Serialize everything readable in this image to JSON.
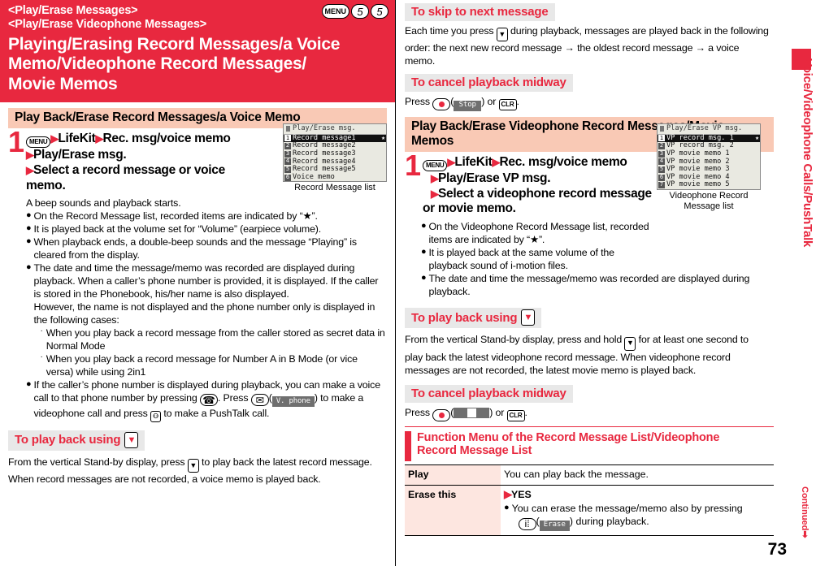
{
  "colors": {
    "accent": "#e8283f",
    "pink_bar": "#f9c9b5",
    "grey_hdr": "#e8e8e8",
    "table_key": "#fde6e0"
  },
  "header": {
    "sub_line1": "<Play/Erase Messages>",
    "sub_line2": "<Play/Erase Videophone Messages>",
    "title_line1": "Playing/Erasing Record Messages/a Voice",
    "title_line2": "Memo/Videophone Record Messages/",
    "title_line3": "Movie Memos",
    "keys": [
      "MENU",
      "5",
      "5"
    ]
  },
  "left": {
    "section_title": "Play Back/Erase Record Messages/a Voice Memo",
    "step": {
      "number": "1",
      "menu_key": "MENU",
      "line1_a": "LifeKit",
      "line1_b": "Rec. msg/voice memo",
      "line2": "Play/Erase msg.",
      "line3": "Select a record message or voice",
      "line4": "memo."
    },
    "intro": "A beep sounds and playback starts.",
    "bullets": [
      "On the Record Message list, recorded items are indicated by “★”.",
      "It is played back at the volume set for “Volume” (earpiece volume).",
      "When playback ends, a double-beep sounds and the message “Playing” is cleared from the display."
    ],
    "bullet_date": {
      "p1": "The date and time the message/memo was recorded are displayed during playback. When a caller’s phone number is provided, it is displayed. If the caller is stored in the Phonebook, his/her name is also displayed.",
      "p2": "However, the name is not displayed and the phone number only is displayed in the following cases:",
      "cases": [
        "When you play back a record message from the caller stored as secret data in Normal Mode",
        "When you play back a record message for Number A in B Mode (or vice versa) while using 2in1"
      ]
    },
    "bullet_call": {
      "a": "If the caller’s phone number is displayed during playback, you can make a voice call to that phone number by pressing",
      "b": ". Press",
      "soft_label": "V. phone",
      "c": ") to make a videophone call and press",
      "d": "to make a PushTalk call."
    },
    "playback_hdr": "To play back using",
    "playback_text_1": "From the vertical Stand-by display, press",
    "playback_text_2": "to play back the latest record message. When record messages are not recorded, a voice memo is played back.",
    "shot": {
      "title": "Play/Erase msg.",
      "items": [
        {
          "idx": "1",
          "label": "Record message1",
          "selected": true,
          "star": true
        },
        {
          "idx": "2",
          "label": "Record message2",
          "selected": false,
          "star": false
        },
        {
          "idx": "3",
          "label": "Record message3",
          "selected": false,
          "star": false
        },
        {
          "idx": "4",
          "label": "Record message4",
          "selected": false,
          "star": false
        },
        {
          "idx": "5",
          "label": "Record message5",
          "selected": false,
          "star": false
        },
        {
          "idx": "6",
          "label": "Voice memo",
          "selected": false,
          "star": false
        }
      ],
      "caption": "Record Message list"
    }
  },
  "right": {
    "skip_hdr": "To skip to next message",
    "skip_text_1": "Each time you press",
    "skip_text_2": "during playback, messages are played back in the following order: the next new record message → the oldest record message → a voice memo.",
    "cancel_hdr_1": "To cancel playback midway",
    "cancel_press": "Press",
    "cancel_stop_label": "Stop",
    "cancel_clr": "CLR",
    "cancel_or": ") or",
    "section_title": "Play Back/Erase Videophone Record Messages/Movie Memos",
    "step": {
      "number": "1",
      "menu_key": "MENU",
      "line1_a": "LifeKit",
      "line1_b": "Rec. msg/voice memo",
      "line2": "Play/Erase VP msg.",
      "line3": "Select a videophone record message",
      "line4": "or movie memo."
    },
    "bullets": [
      "On the Videophone Record Message list, recorded items are indicated by “★”.",
      "It is played back at the same volume of the playback sound of i-motion files.",
      "The date and time the message/memo was recorded are displayed during playback."
    ],
    "playback_hdr": "To play back using",
    "playback_text_1": "From the vertical Stand-by display, press and hold",
    "playback_text_2": "for at least one second to play back the latest videophone record message. When videophone record messages are not recorded, the latest movie memo is played back.",
    "cancel_hdr_2": "To cancel playback midway",
    "shot": {
      "title": "Play/Erase VP msg.",
      "items": [
        {
          "idx": "1",
          "label": "VP record msg. 1",
          "selected": true,
          "star": true
        },
        {
          "idx": "2",
          "label": "VP record msg. 2",
          "selected": false,
          "star": false
        },
        {
          "idx": "3",
          "label": "VP movie memo 1",
          "selected": false,
          "star": false
        },
        {
          "idx": "4",
          "label": "VP movie memo 2",
          "selected": false,
          "star": false
        },
        {
          "idx": "5",
          "label": "VP movie memo 3",
          "selected": false,
          "star": false
        },
        {
          "idx": "6",
          "label": "VP movie memo 4",
          "selected": false,
          "star": false
        },
        {
          "idx": "7",
          "label": "VP movie memo 5",
          "selected": false,
          "star": false
        }
      ],
      "caption_1": "Videophone Record",
      "caption_2": "Message list"
    },
    "fn_menu": {
      "title_line1": "Function Menu of the Record Message List/Videophone",
      "title_line2": "Record Message List",
      "rows": [
        {
          "key": "Play",
          "value": "You can play back the message."
        },
        {
          "key": "Erase this",
          "value": "YES"
        }
      ],
      "erase_note_a": "You can erase the message/memo also by pressing",
      "erase_soft_label": "Erase",
      "erase_note_b": ") during playback."
    }
  },
  "sidebar": {
    "vertical_text": "Voice/Videophone Calls/PushTalk"
  },
  "footer": {
    "continued": "Continued➡",
    "page_number": "73"
  }
}
